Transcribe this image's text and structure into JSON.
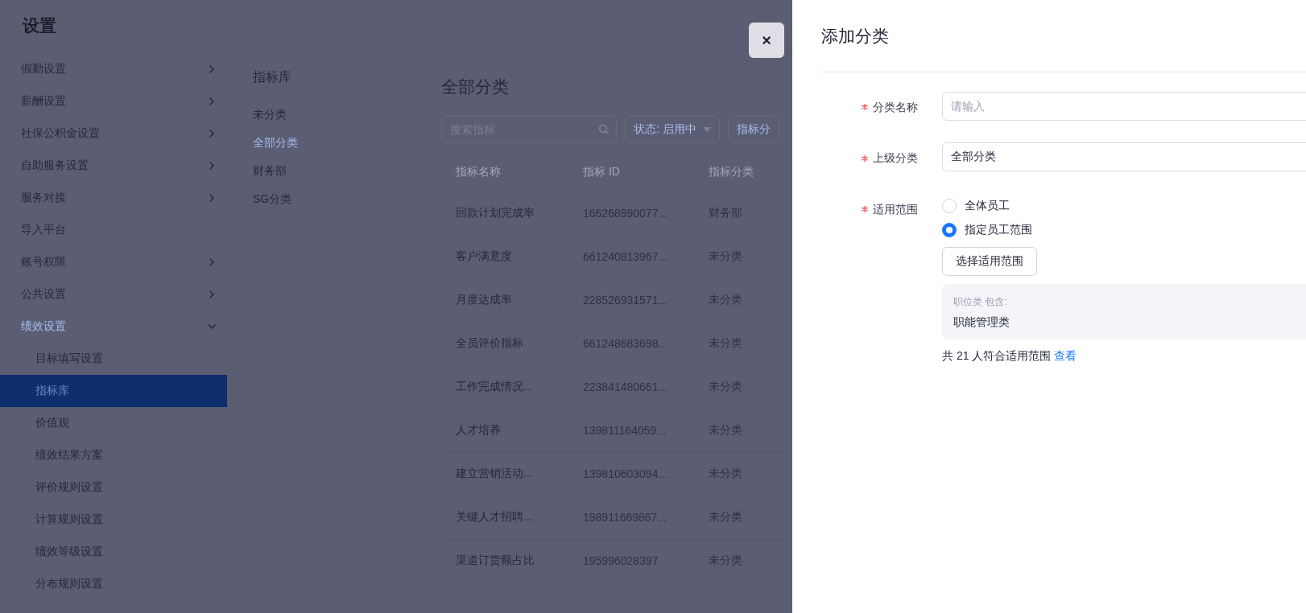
{
  "header": {
    "title": "设置"
  },
  "sidebar": {
    "items": [
      {
        "label": "假勤设置",
        "kind": "group",
        "expanded": false
      },
      {
        "label": "薪酬设置",
        "kind": "group",
        "expanded": false
      },
      {
        "label": "社保公积金设置",
        "kind": "group",
        "expanded": false
      },
      {
        "label": "自助服务设置",
        "kind": "group",
        "expanded": false
      },
      {
        "label": "服务对接",
        "kind": "group",
        "expanded": false
      },
      {
        "label": "导入平台",
        "kind": "link"
      },
      {
        "label": "账号权限",
        "kind": "group",
        "expanded": false
      },
      {
        "label": "公共设置",
        "kind": "group",
        "expanded": false
      },
      {
        "label": "绩效设置",
        "kind": "group",
        "expanded": true,
        "children": [
          {
            "label": "目标填写设置",
            "selected": false
          },
          {
            "label": "指标库",
            "selected": true
          },
          {
            "label": "价值观",
            "selected": false
          },
          {
            "label": "绩效结果方案",
            "selected": false
          },
          {
            "label": "评价规则设置",
            "selected": false
          },
          {
            "label": "计算规则设置",
            "selected": false
          },
          {
            "label": "绩效等级设置",
            "selected": false
          },
          {
            "label": "分布规则设置",
            "selected": false
          }
        ]
      }
    ]
  },
  "subnav": {
    "title": "指标库",
    "items": [
      {
        "label": "未分类",
        "selected": false
      },
      {
        "label": "全部分类",
        "selected": true
      },
      {
        "label": "财务部",
        "selected": false
      },
      {
        "label": "SG分类",
        "selected": false
      }
    ]
  },
  "main": {
    "title": "全部分类",
    "search": {
      "placeholder": "搜索指标"
    },
    "filters": [
      {
        "label": "状态: 启用中",
        "kind": "dropdown"
      },
      {
        "label": "指标分",
        "kind": "button"
      }
    ],
    "table": {
      "columns": [
        "指标名称",
        "指标 ID",
        "指标分类"
      ],
      "rows": [
        [
          "回款计划完成率",
          "166268990077...",
          "财务部"
        ],
        [
          "客户满意度",
          "661240813967...",
          "未分类"
        ],
        [
          "月度达成率",
          "228526931571...",
          "未分类"
        ],
        [
          "全员评价指标",
          "661248683698...",
          "未分类"
        ],
        [
          "工作完成情况...",
          "223841480661...",
          "未分类"
        ],
        [
          "人才培养",
          "139811164059...",
          "未分类"
        ],
        [
          "建立营销活动...",
          "139810603094...",
          "未分类"
        ],
        [
          "关键人才招聘...",
          "198911669867...",
          "未分类"
        ],
        [
          "渠道订货额占比",
          "195996028397",
          "未分类"
        ]
      ]
    }
  },
  "drawer": {
    "close": "×",
    "title": "添加分类",
    "fields": [
      {
        "kind": "input",
        "label": "分类名称",
        "required": true,
        "placeholder": "请输入"
      },
      {
        "kind": "input",
        "label": "上级分类",
        "required": true,
        "value": "全部分类"
      },
      {
        "kind": "scope",
        "label": "适用范围",
        "required": true,
        "options": [
          {
            "label": "全体员工",
            "selected": false
          },
          {
            "label": "指定员工范围",
            "selected": true
          }
        ],
        "button": "选择适用范围",
        "scope": {
          "caption": "职位类 包含:",
          "value": "职能管理类"
        },
        "summary": "共 21 人符合适用范围",
        "link": "查看"
      }
    ]
  }
}
